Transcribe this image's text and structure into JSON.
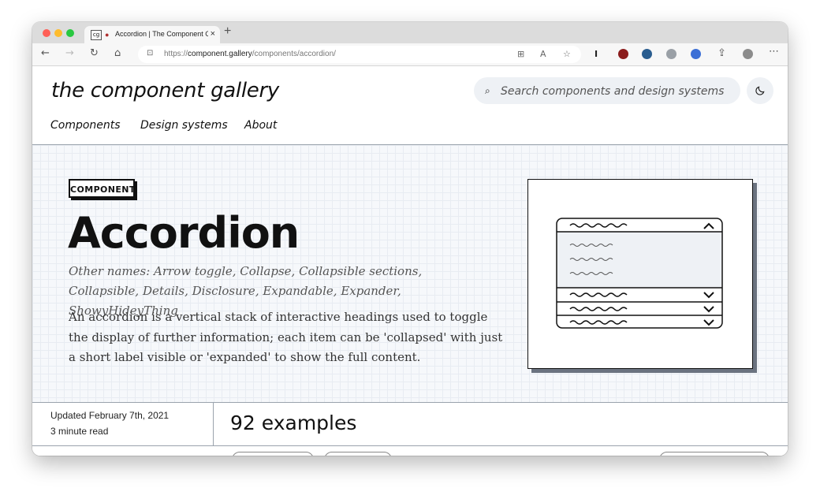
{
  "browser": {
    "tab_favicon": "cg",
    "tab_title": "Accordion | The Component Gallery",
    "tab_close": "×",
    "new_tab": "+",
    "url_prefix": "https://",
    "url_host": "component.gallery",
    "url_path": "/components/accordion/"
  },
  "header": {
    "logo": "the component gallery",
    "search_placeholder": "Search components and design systems",
    "nav": [
      "Components",
      "Design systems",
      "About"
    ]
  },
  "hero": {
    "badge": "COMPONENT",
    "title": "Accordion",
    "other_names": "Other names: Arrow toggle, Collapse, Collapsible sections, Collapsible, Details, Disclosure, Expandable, Expander, ShowyHideyThing",
    "description": "An accordion is a vertical stack of interactive headings used to toggle the display of further information; each item can be 'collapsed' with just a short label visible or 'expanded' to show the full content."
  },
  "meta": {
    "updated": "Updated February 7th, 2021",
    "read_time": "3 minute read",
    "examples": "92 examples"
  },
  "icons": {
    "back": "arrow-left-icon",
    "forward": "arrow-right-icon",
    "reload": "reload-icon",
    "home": "home-icon",
    "lock": "lock-icon",
    "search": "search-icon",
    "theme": "moon-icon"
  },
  "colors": {
    "hero_bg": "#f6f8fb",
    "accent_shadow": "#6b7380",
    "search_bg": "#eef1f5"
  }
}
